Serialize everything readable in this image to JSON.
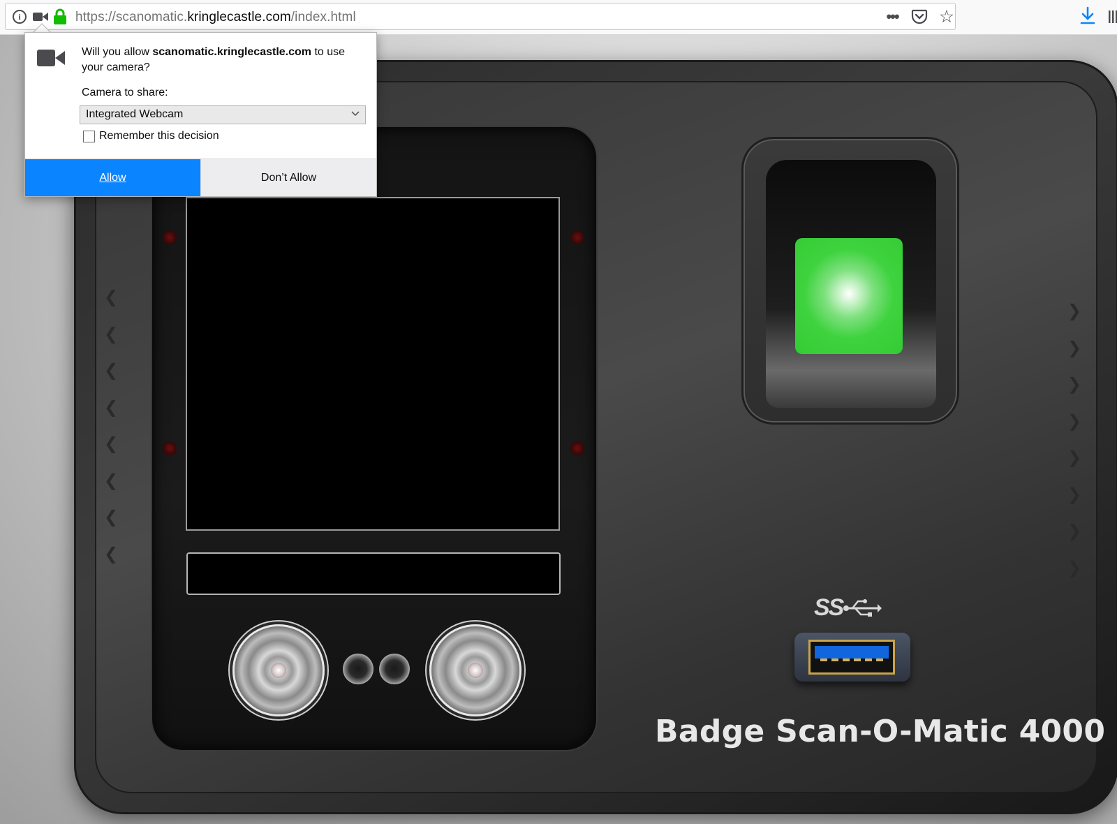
{
  "browser": {
    "url_prefix": "https://scanomatic.",
    "url_host": "kringlecastle.com",
    "url_path": "/index.html",
    "info_glyph": "i",
    "more_glyph": "•••",
    "star_glyph": "☆"
  },
  "permission_prompt": {
    "message_pre": "Will you allow ",
    "message_host": "scanomatic.kringlecastle.com",
    "message_post": " to use your camera?",
    "share_label": "Camera to share:",
    "selected_camera": "Integrated Webcam",
    "remember_label": "Remember this decision",
    "remember_checked": false,
    "allow_label": "Allow",
    "deny_label": "Don’t Allow",
    "allow_color": "#0a84ff"
  },
  "device": {
    "model_name": "Badge Scan-O-Matic 4000",
    "usb_logo_text": "SS",
    "fingerprint_pad_color": "#33cc33",
    "grip_glyph": "❮"
  }
}
